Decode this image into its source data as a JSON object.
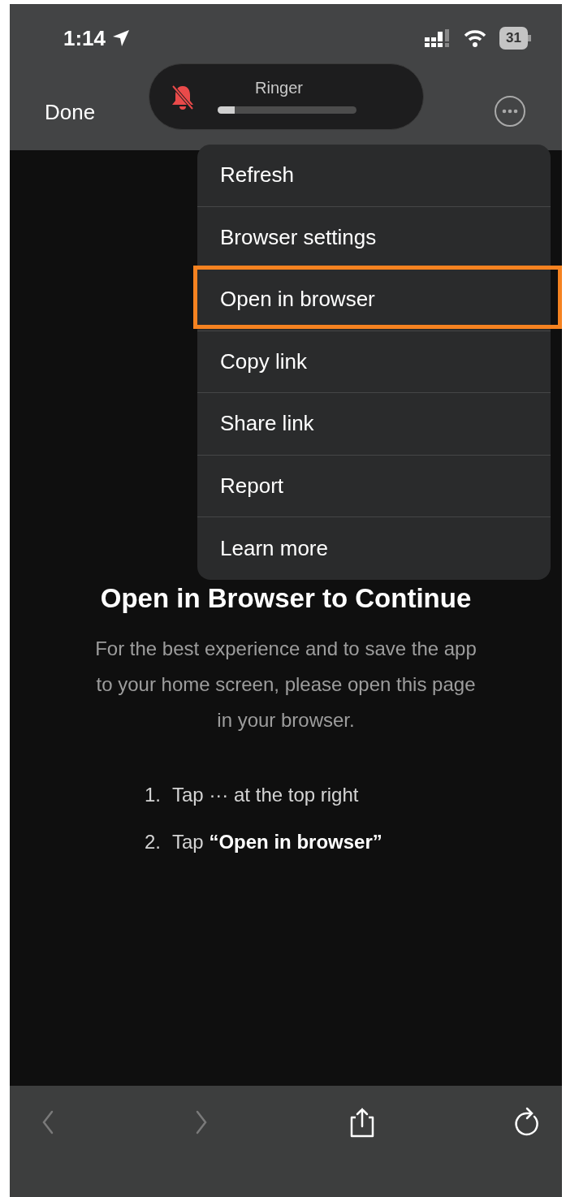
{
  "status_bar": {
    "time": "1:14",
    "battery": "31"
  },
  "ringer": {
    "label": "Ringer",
    "muted": true,
    "level": 0.12
  },
  "header": {
    "done": "Done"
  },
  "menu": {
    "items": [
      {
        "label": "Refresh",
        "highlighted": false
      },
      {
        "label": "Browser settings",
        "highlighted": false
      },
      {
        "label": "Open in browser",
        "highlighted": true
      },
      {
        "label": "Copy link",
        "highlighted": false
      },
      {
        "label": "Share link",
        "highlighted": false
      },
      {
        "label": "Report",
        "highlighted": false
      },
      {
        "label": "Learn more",
        "highlighted": false
      }
    ]
  },
  "content": {
    "title": "Open in Browser to Continue",
    "message": "For the best experience and to save the app to your home screen, please open this page in your browser.",
    "steps": [
      {
        "number": "1.",
        "text": "Tap ··· at the top right"
      },
      {
        "number": "2.",
        "text": "Tap **“Open in browser”**"
      }
    ]
  },
  "toolbar": {
    "items": [
      {
        "kind": "back",
        "disabled": true
      },
      {
        "kind": "forward",
        "disabled": true
      },
      {
        "kind": "share",
        "disabled": false
      },
      {
        "kind": "reload",
        "disabled": false
      }
    ]
  }
}
